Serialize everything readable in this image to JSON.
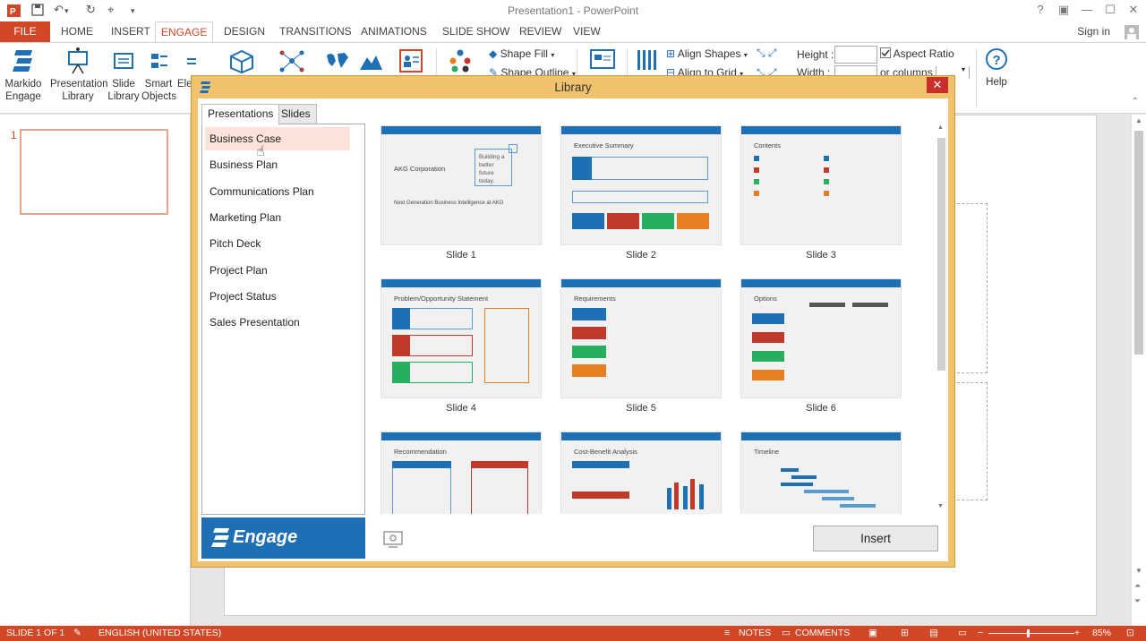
{
  "window": {
    "title": "Presentation1 - PowerPoint",
    "sign_in": "Sign in"
  },
  "ribbon_tabs": [
    "FILE",
    "HOME",
    "INSERT",
    "ENGAGE",
    "DESIGN",
    "TRANSITIONS",
    "ANIMATIONS",
    "SLIDE SHOW",
    "REVIEW",
    "VIEW"
  ],
  "ribbon": {
    "markido_engage": "Markido Engage",
    "presentation_library": "Presentation Library",
    "slide_library": "Slide Library",
    "smart_objects": "Smart Objects",
    "ele": "Ele",
    "shape_fill": "Shape Fill",
    "shape_outline": "Shape Outline",
    "align_shapes": "Align Shapes",
    "align_to_grid": "Align to Grid",
    "height_label": "Height :",
    "width_label": "Width :",
    "aspect_ratio": "Aspect Ratio",
    "or_columns": "or columns :",
    "help": "Help"
  },
  "thumbnail_pane": {
    "slide_number": "1"
  },
  "status": {
    "slide": "SLIDE 1 OF 1",
    "language": "ENGLISH (UNITED STATES)",
    "notes": "NOTES",
    "comments": "COMMENTS",
    "zoom": "85%"
  },
  "dialog": {
    "title": "Library",
    "tabs": [
      "Presentations",
      "Slides"
    ],
    "presentations": [
      "Business Case",
      "Business Plan",
      "Communications Plan",
      "Marketing Plan",
      "Pitch Deck",
      "Project Plan",
      "Project Status",
      "Sales Presentation"
    ],
    "selected_index": 0,
    "banner": "Engage",
    "insert_button": "Insert",
    "slides": [
      {
        "label": "Slide 1",
        "title": "AKG Corporation"
      },
      {
        "label": "Slide 2",
        "title": "Executive Summary"
      },
      {
        "label": "Slide 3",
        "title": "Contents"
      },
      {
        "label": "Slide 4",
        "title": "Problem/Opportunity Statement"
      },
      {
        "label": "Slide 5",
        "title": "Requirements"
      },
      {
        "label": "Slide 6",
        "title": "Options"
      },
      {
        "label": "",
        "title": "Recommendation"
      },
      {
        "label": "",
        "title": "Cost-Benefit Analysis"
      },
      {
        "label": "",
        "title": "Timeline"
      }
    ],
    "slide1_callout": "Building a better future today.",
    "slide1_subtitle": "Next Generation Business Intelligence at AKG"
  },
  "colors": {
    "accent": "#d24726",
    "brand_blue": "#1f6fb5",
    "dialog_frame": "#f0c26d"
  }
}
